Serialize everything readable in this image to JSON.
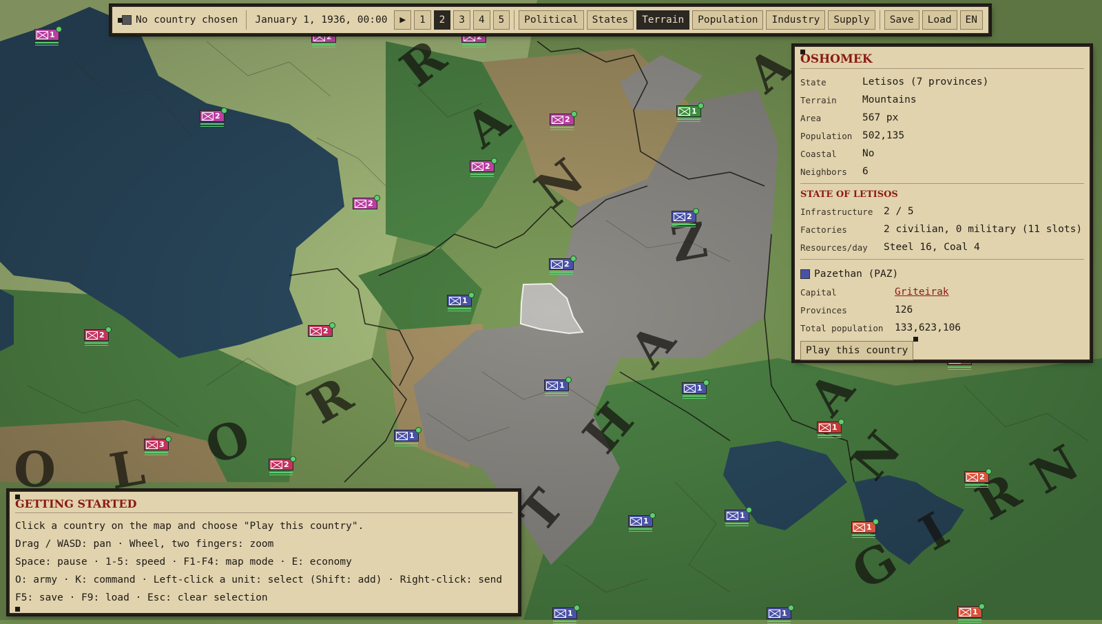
{
  "topbar": {
    "country": "No country chosen",
    "date": "January 1, 1936, 00:00",
    "play_symbol": "▶",
    "speeds": [
      "1",
      "2",
      "3",
      "4",
      "5"
    ],
    "active_speed": "2",
    "map_modes": [
      "Political",
      "States",
      "Terrain",
      "Population",
      "Industry",
      "Supply"
    ],
    "active_mode": "Terrain",
    "save_label": "Save",
    "load_label": "Load",
    "lang_label": "EN"
  },
  "info": {
    "province_name": "OSHOMEK",
    "state_label": "State",
    "state_value": "Letisos (7 provinces)",
    "terrain_label": "Terrain",
    "terrain_value": "Mountains",
    "area_label": "Area",
    "area_value": "567 px",
    "population_label": "Population",
    "population_value": "502,135",
    "coastal_label": "Coastal",
    "coastal_value": "No",
    "neighbors_label": "Neighbors",
    "neighbors_value": "6",
    "state_heading": "STATE OF LETISOS",
    "infra_label": "Infrastructure",
    "infra_value": "2 / 5",
    "factories_label": "Factories",
    "factories_value": "2 civilian, 0 military (11 slots)",
    "resources_label": "Resources/day",
    "resources_value": "Steel 16, Coal 4",
    "country_name": "Pazethan (PAZ)",
    "country_color": "#4a52a6",
    "capital_label": "Capital",
    "capital_value": "Griteirak",
    "provinces_label": "Provinces",
    "provinces_value": "126",
    "total_pop_label": "Total population",
    "total_pop_value": "133,623,106",
    "play_button": "Play this country"
  },
  "help": {
    "title": "GETTING STARTED",
    "lines": [
      "Click a country on the map and choose \"Play this country\".",
      "Drag / WASD: pan · Wheel, two fingers: zoom",
      "Space: pause · 1-5: speed · F1-F4: map mode · E: economy",
      "O: army · K: command · Left-click a unit: select (Shift: add) · Right-click: send",
      "F5: save · F9: load · Esc: clear selection"
    ]
  },
  "map_labels": {
    "north": [
      "R",
      "A",
      "N",
      "Z"
    ],
    "pazethan": [
      "N",
      "A",
      "H",
      "T"
    ],
    "south_west": [
      "O",
      "L",
      "O",
      "R"
    ],
    "east": [
      "A",
      "N",
      "Z",
      "A"
    ],
    "giran": [
      "G",
      "I",
      "R",
      "N"
    ]
  },
  "units": [
    {
      "count": "1",
      "color": "#b93fa0"
    },
    {
      "count": "2",
      "color": "#b93fa0"
    },
    {
      "count": "2",
      "color": "#b93fa0"
    },
    {
      "count": "2",
      "color": "#b93fa0"
    },
    {
      "count": "2",
      "color": "#b93fa0"
    },
    {
      "count": "2",
      "color": "#b93fa0"
    },
    {
      "count": "1",
      "color": "#3a8f3a"
    },
    {
      "count": "2",
      "color": "#4a52a6"
    },
    {
      "count": "2",
      "color": "#4a52a6"
    },
    {
      "count": "1",
      "color": "#4a52a6"
    },
    {
      "count": "2",
      "color": "#c33360"
    },
    {
      "count": "2",
      "color": "#c33360"
    },
    {
      "count": "1",
      "color": "#4a52a6"
    },
    {
      "count": "1",
      "color": "#4a52a6"
    },
    {
      "count": "1",
      "color": "#4a52a6"
    },
    {
      "count": "3",
      "color": "#c33360"
    },
    {
      "count": "2",
      "color": "#c33360"
    },
    {
      "count": "1",
      "color": "#c23a3a"
    },
    {
      "count": "2",
      "color": "#d5533e"
    },
    {
      "count": "1",
      "color": "#d5533e"
    },
    {
      "count": "1",
      "color": "#4a52a6"
    },
    {
      "count": "1",
      "color": "#4a52a6"
    },
    {
      "count": "2",
      "color": "#b93fa0"
    },
    {
      "count": "2",
      "color": "#d5533e"
    },
    {
      "count": "1",
      "color": "#4a52a6"
    },
    {
      "count": "1",
      "color": "#4a52a6"
    },
    {
      "count": "1",
      "color": "#d5533e"
    }
  ]
}
